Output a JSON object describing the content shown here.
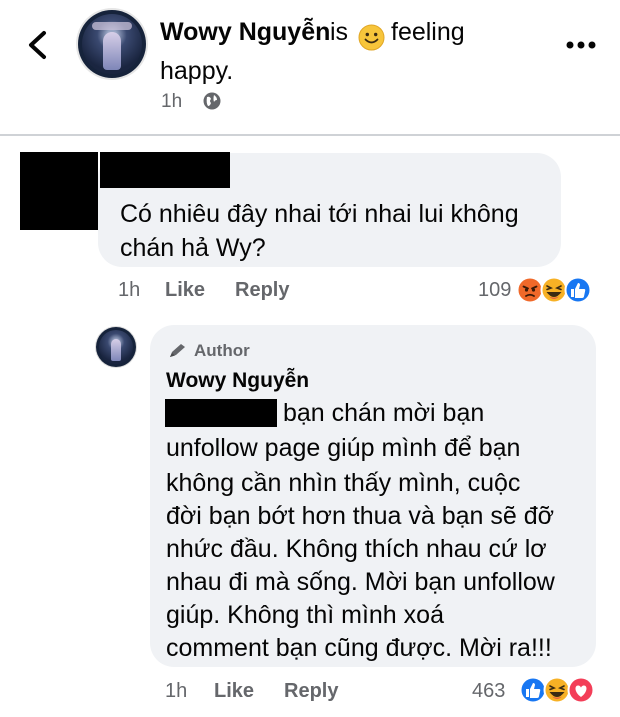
{
  "post": {
    "author": "Wowy Nguyễn",
    "is": "is",
    "feeling_emoji": "smiling-face-icon",
    "feeling": "feeling",
    "feeling_value": "happy.",
    "time": "1h"
  },
  "comment": {
    "text": "Có nhiêu đây nhai tới nhai lui không chán hả Wy?",
    "time": "1h",
    "like_label": "Like",
    "reply_label": "Reply",
    "reaction_count": "109",
    "reactions": [
      "angry-icon",
      "haha-icon",
      "like-icon"
    ]
  },
  "reply": {
    "badge": "Author",
    "author": "Wowy Nguyễn",
    "lines": [
      "bạn chán mời bạn",
      "unfollow page giúp mình để bạn",
      "không cần nhìn thấy mình, cuộc",
      "đời bạn bớt hơn thua và bạn sẽ đỡ",
      "nhức đầu. Không thích nhau cứ lơ",
      "nhau đi mà sống. Mời bạn unfollow",
      "giúp. Không thì mình xoá",
      "comment bạn cũng được. Mời ra!!!"
    ],
    "time": "1h",
    "like_label": "Like",
    "reply_label": "Reply",
    "reaction_count": "463",
    "reactions": [
      "like-icon",
      "haha-icon",
      "love-icon"
    ]
  },
  "colors": {
    "bubble": "#f0f2f5",
    "meta_text": "#65676b",
    "like_blue": "#1877f2",
    "love_red": "#f33e58",
    "reaction_yellow": "#f7b125"
  }
}
